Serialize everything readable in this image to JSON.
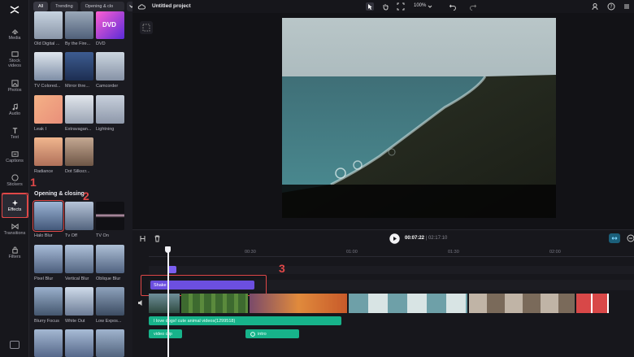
{
  "nav": {
    "items": [
      {
        "label": "Media",
        "icon": "media-icon"
      },
      {
        "label": "Stock\nvideos",
        "icon": "stock-videos-icon"
      },
      {
        "label": "Photos",
        "icon": "photos-icon"
      },
      {
        "label": "Audio",
        "icon": "audio-icon"
      },
      {
        "label": "Text",
        "icon": "text-icon"
      },
      {
        "label": "Captions",
        "icon": "captions-icon"
      },
      {
        "label": "Stickers",
        "icon": "stickers-icon"
      },
      {
        "label": "Effects",
        "icon": "effects-icon"
      },
      {
        "label": "Transitions",
        "icon": "transitions-icon"
      },
      {
        "label": "Filters",
        "icon": "filters-icon"
      }
    ]
  },
  "panel": {
    "filters": [
      "All",
      "Trending",
      "Opening & clo"
    ],
    "effects_row1": [
      "Old Digital ...",
      "By the Fire...",
      "DVD"
    ],
    "effects_row2": [
      "TV Colored...",
      "Mirror thre...",
      "Camcorder"
    ],
    "effects_row3": [
      "Leak I",
      "Extravagan...",
      "Lightning"
    ],
    "effects_row4": [
      "Radiance",
      "Dot Silkscr..."
    ],
    "section_title": "Opening & closing",
    "opening_row1": [
      "Halo Blur",
      "Tv Off",
      "TV On"
    ],
    "opening_row2": [
      "Pixel Blur",
      "Vertical Blur",
      "Oblique Blur"
    ],
    "opening_row3": [
      "Blurry Focus",
      "White Out",
      "Low Expos..."
    ]
  },
  "topbar": {
    "title": "Untitled project",
    "zoom": "100%"
  },
  "timeline": {
    "current": "00:07:22",
    "separator": " | ",
    "total": "02:17:10",
    "ruler": [
      "00:00",
      "00:30",
      "01:00",
      "01:30",
      "02:00"
    ],
    "effect_clip": "Shake",
    "audio_clip": "I love dogs! cute animal videos(1299518)",
    "voice_clip": "video clip",
    "intro_clip": "intro"
  },
  "annotations": [
    "1",
    "2",
    "3"
  ],
  "colors": {
    "highlight": "#e04848",
    "effect_clip": "#6c4fe0",
    "audio_clip": "#17b38a"
  }
}
